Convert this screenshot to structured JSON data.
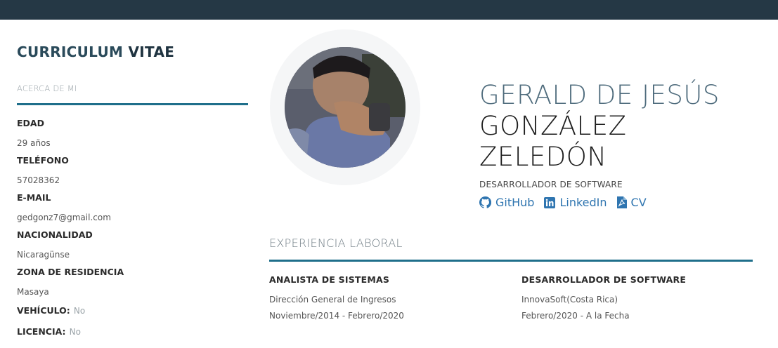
{
  "sidebar": {
    "title_part1": "CURRICULUM",
    "title_part2": "VITAE",
    "section_label": "ACERCA DE MI",
    "fields": [
      {
        "label": "EDAD",
        "value": "29 años"
      },
      {
        "label": "TELÉFONO",
        "value": "57028362"
      },
      {
        "label": "E-MAIL",
        "value": "gedgonz7@gmail.com"
      },
      {
        "label": "NACIONALIDAD",
        "value": "Nicaragünse"
      },
      {
        "label": "ZONA DE RESIDENCIA",
        "value": "Masaya"
      }
    ],
    "inline_fields": [
      {
        "label": "VEHÍCULO:",
        "value": "No"
      },
      {
        "label": "LICENCIA:",
        "value": "No"
      }
    ]
  },
  "profile": {
    "name_line1": "GERALD DE JESÚS",
    "name_line2": "GONZÁLEZ",
    "name_line3": "ZELEDÓN",
    "role": "DESARROLLADOR DE SOFTWARE",
    "links": [
      {
        "label": "GitHub",
        "icon": "github-icon"
      },
      {
        "label": "LinkedIn",
        "icon": "linkedin-icon"
      },
      {
        "label": "CV",
        "icon": "pdf-icon"
      }
    ]
  },
  "experience": {
    "heading": "EXPERIENCIA LABORAL",
    "jobs": [
      {
        "title": "ANALISTA DE SISTEMAS",
        "company": "Dirección General de Ingresos",
        "dates": "Noviembre/2014 - Febrero/2020"
      },
      {
        "title": "DESARROLLADOR DE SOFTWARE",
        "company": "InnovaSoft(Costa Rica)",
        "dates": "Febrero/2020 - A la Fecha"
      }
    ]
  },
  "colors": {
    "topbar": "#253845",
    "accent_rule": "#1f6f8b",
    "link": "#2f75b0"
  }
}
